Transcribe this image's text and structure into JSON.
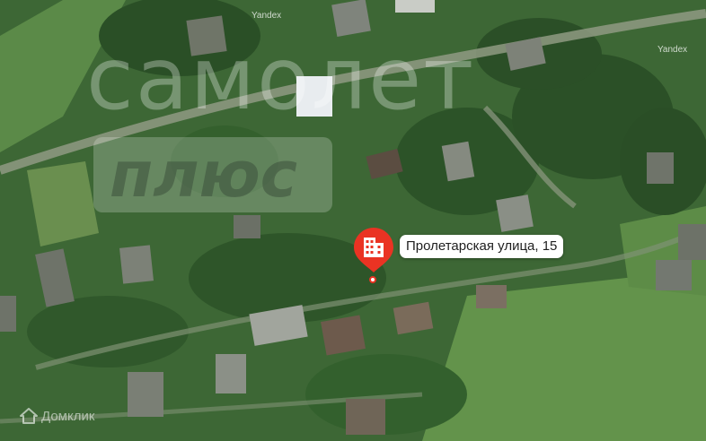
{
  "map": {
    "attribution": [
      "Yandex",
      "Yandex"
    ],
    "watermark_title": "самолет",
    "watermark_subtitle": "плюс",
    "brand": "Домклик",
    "brand_icon": "house-logo-icon"
  },
  "marker": {
    "address": "Пролетарская улица, 15",
    "icon": "building-icon",
    "color": "#ea3323"
  },
  "colors": {
    "vegetation_dark": "#2f5a2a",
    "vegetation_mid": "#4f7d3f",
    "field_light": "#6c9c54",
    "road": "#9aa38c",
    "roof": "#8a8f86"
  }
}
